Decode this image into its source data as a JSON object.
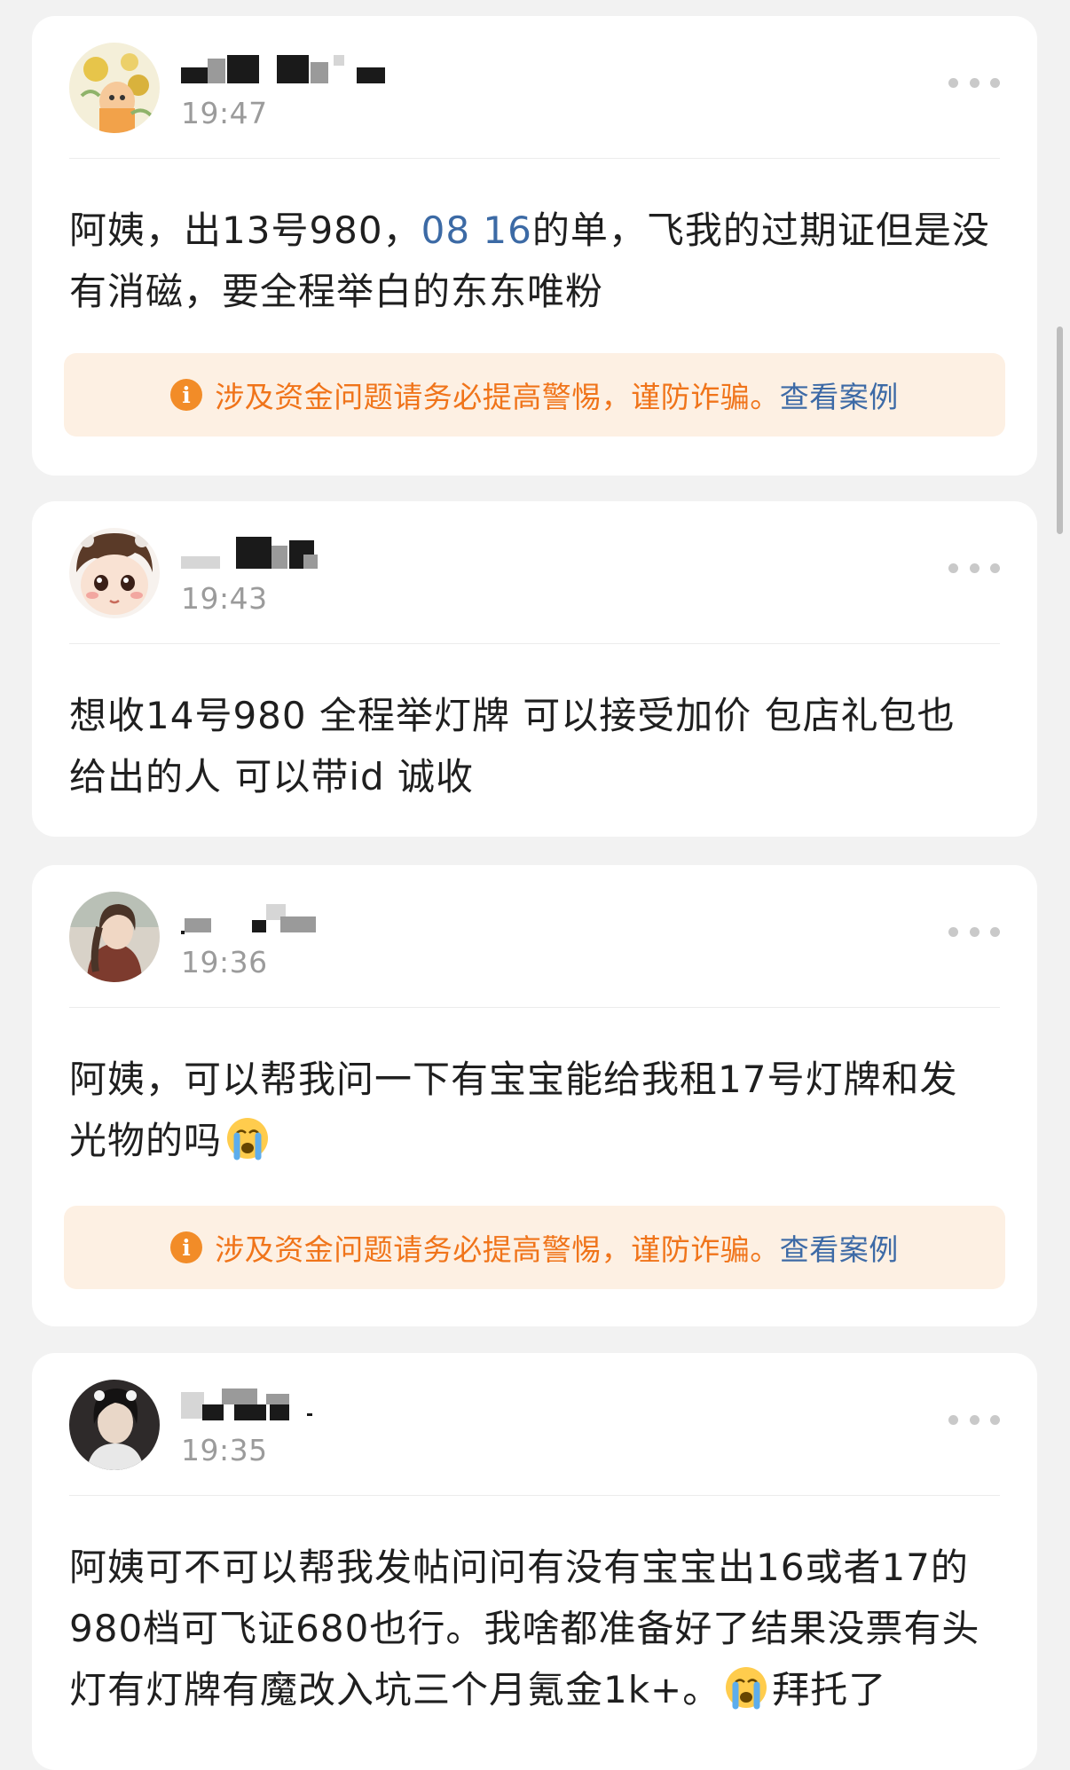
{
  "warning": {
    "icon": "info-icon",
    "text": "涉及资金问题请务必提高警惕，谨防诈骗。",
    "link": "查看案例"
  },
  "posts": [
    {
      "avatar": "avatar-yellow-flowers",
      "time": "19:47",
      "content_a": "阿姨，出13号980，",
      "content_link": "08 16",
      "content_b": "的单，飞我的过期证但是没有消磁，要全程举白的东东唯粉",
      "has_warning": true
    },
    {
      "avatar": "avatar-cartoon-doll",
      "time": "19:43",
      "content": "想收14号980 全程举灯牌 可以接受加价 包店礼包也给出的人 可以带id 诚收",
      "has_warning": false
    },
    {
      "avatar": "avatar-girl-photo",
      "time": "19:36",
      "content": "阿姨，可以帮我问一下有宝宝能给我租17号灯牌和发光物的吗",
      "emoji": "crying-face-emoji",
      "has_warning": true
    },
    {
      "avatar": "avatar-portrait-photo",
      "time": "19:35",
      "content_a": "阿姨可不可以帮我发帖问问有没有宝宝出16或者17的980档可飞证680也行。我啥都准备好了结果没票有头灯有灯牌有魔改入坑三个月氪金1k+。",
      "content_b": "拜托了",
      "emoji": "crying-face-emoji",
      "has_warning": false
    }
  ],
  "colors": {
    "background": "#f2f2f2",
    "card": "#ffffff",
    "link": "#3c6aa5",
    "warning_text": "#f0741a",
    "warning_bg": "#fdf0e3",
    "time": "#9b9b9b"
  }
}
